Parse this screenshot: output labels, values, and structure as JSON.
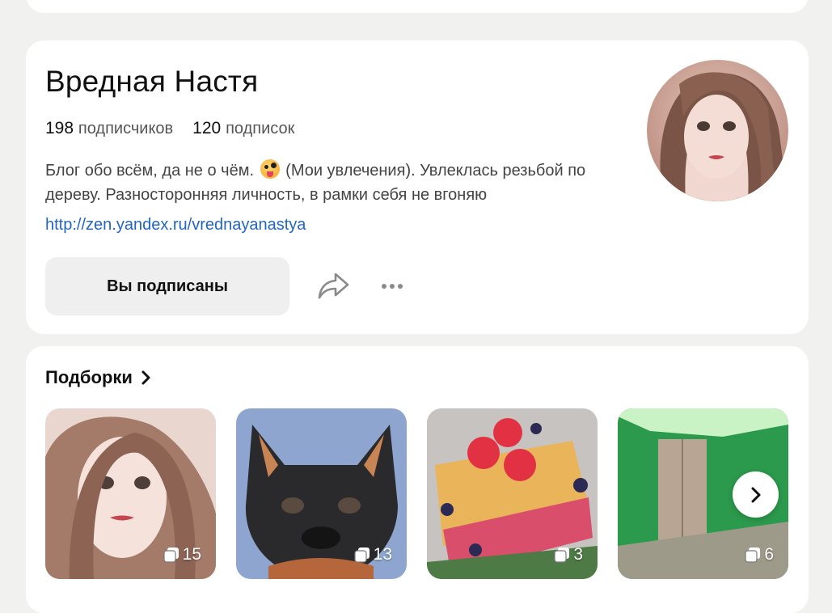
{
  "profile": {
    "name": "Вредная Настя",
    "subscribers_count": "198",
    "subscribers_label": "подписчиков",
    "subscriptions_count": "120",
    "subscriptions_label": "подписок",
    "description_part1": "Блог обо всём, да не о чём.",
    "description_part2": "(Мои увлечения). Увлеклась резьбой по дереву. Разносторонняя личность, в рамки себя не вгоняю",
    "link": "http://zen.yandex.ru/vrednayanastya",
    "subscribe_state_label": "Вы подписаны",
    "avatar_icon": "avatar-photo"
  },
  "collections": {
    "title": "Подборки",
    "items": [
      {
        "count": "15",
        "icon": "stack-icon"
      },
      {
        "count": "13",
        "icon": "stack-icon"
      },
      {
        "count": "3",
        "icon": "stack-icon"
      },
      {
        "count": "6",
        "icon": "stack-icon"
      }
    ]
  },
  "colors": {
    "link": "#2266c3",
    "button_bg": "#efefef",
    "page_bg": "#f1f1ef"
  }
}
